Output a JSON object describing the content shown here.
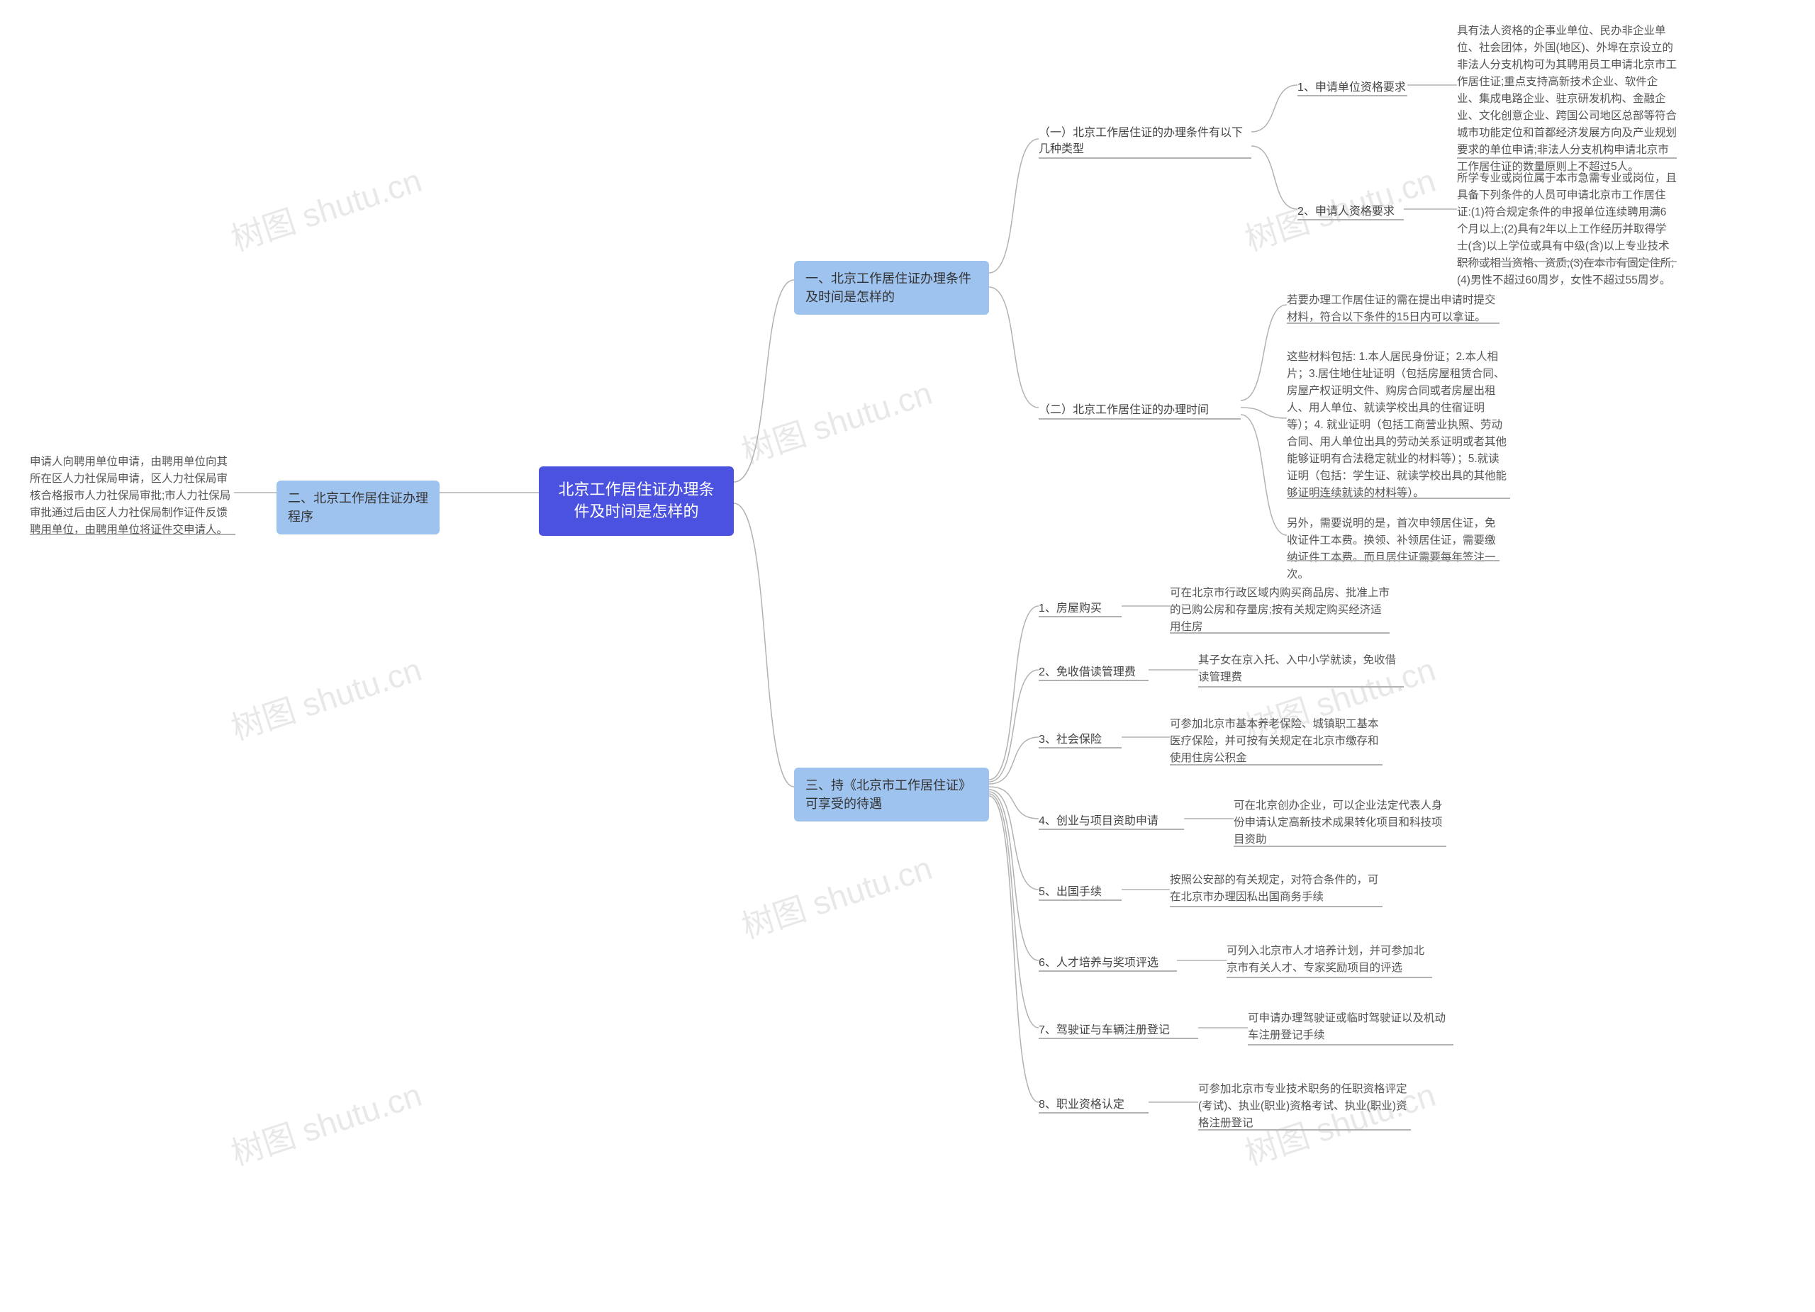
{
  "watermark": "树图 shutu.cn",
  "root": "北京工作居住证办理条件及时间是怎样的",
  "section1": {
    "title": "一、北京工作居住证办理条件及时间是怎样的",
    "part1": {
      "title": "（一）北京工作居住证的办理条件有以下几种类型",
      "item1": {
        "label": "1、申请单位资格要求",
        "detail": "具有法人资格的企事业单位、民办非企业单位、社会团体，外国(地区)、外埠在京设立的非法人分支机构可为其聘用员工申请北京市工作居住证;重点支持高新技术企业、软件企业、集成电路企业、驻京研发机构、金融企业、文化创意企业、跨国公司地区总部等符合城市功能定位和首都经济发展方向及产业规划要求的单位申请;非法人分支机构申请北京市工作居住证的数量原则上不超过5人。"
      },
      "item2": {
        "label": "2、申请人资格要求",
        "detail": "所学专业或岗位属于本市急需专业或岗位，且具备下列条件的人员可申请北京市工作居住证:(1)符合规定条件的申报单位连续聘用满6个月以上;(2)具有2年以上工作经历并取得学士(含)以上学位或具有中级(含)以上专业技术职称或相当资格、资质;(3)在本市有固定住所;(4)男性不超过60周岁，女性不超过55周岁。"
      }
    },
    "part2": {
      "title": "（二）北京工作居住证的办理时间",
      "detail1": "若要办理工作居住证的需在提出申请时提交材料，符合以下条件的15日内可以拿证。",
      "detail2": "这些材料包括: 1.本人居民身份证；2.本人相片；3.居住地住址证明（包括房屋租赁合同、房屋产权证明文件、购房合同或者房屋出租人、用人单位、就读学校出具的住宿证明等）；4. 就业证明（包括工商营业执照、劳动合同、用人单位出具的劳动关系证明或者其他能够证明有合法稳定就业的材料等）；5.就读证明（包括：学生证、就读学校出具的其他能够证明连续就读的材料等）。",
      "detail3": "另外，需要说明的是，首次申领居住证，免收证件工本费。换领、补领居住证，需要缴纳证件工本费。而且居住证需要每年签注一次。"
    }
  },
  "section2": {
    "title": "二、北京工作居住证办理程序",
    "detail": "申请人向聘用单位申请，由聘用单位向其所在区人力社保局申请，区人力社保局审核合格报市人力社保局审批;市人力社保局审批通过后由区人力社保局制作证件反馈聘用单位，由聘用单位将证件交申请人。"
  },
  "section3": {
    "title": "三、持《北京市工作居住证》可享受的待遇",
    "items": {
      "i1": {
        "label": "1、房屋购买",
        "detail": "可在北京市行政区域内购买商品房、批准上市的已购公房和存量房;按有关规定购买经济适用住房"
      },
      "i2": {
        "label": "2、免收借读管理费",
        "detail": "其子女在京入托、入中小学就读，免收借读管理费"
      },
      "i3": {
        "label": "3、社会保险",
        "detail": "可参加北京市基本养老保险、城镇职工基本医疗保险，并可按有关规定在北京市缴存和使用住房公积金"
      },
      "i4": {
        "label": "4、创业与项目资助申请",
        "detail": "可在北京创办企业，可以企业法定代表人身份申请认定高新技术成果转化项目和科技项目资助"
      },
      "i5": {
        "label": "5、出国手续",
        "detail": "按照公安部的有关规定，对符合条件的，可在北京市办理因私出国商务手续"
      },
      "i6": {
        "label": "6、人才培养与奖项评选",
        "detail": "可列入北京市人才培养计划，并可参加北京市有关人才、专家奖励项目的评选"
      },
      "i7": {
        "label": "7、驾驶证与车辆注册登记",
        "detail": "可申请办理驾驶证或临时驾驶证以及机动车注册登记手续"
      },
      "i8": {
        "label": "8、职业资格认定",
        "detail": "可参加北京市专业技术职务的任职资格评定(考试)、执业(职业)资格考试、执业(职业)资格注册登记"
      }
    }
  }
}
